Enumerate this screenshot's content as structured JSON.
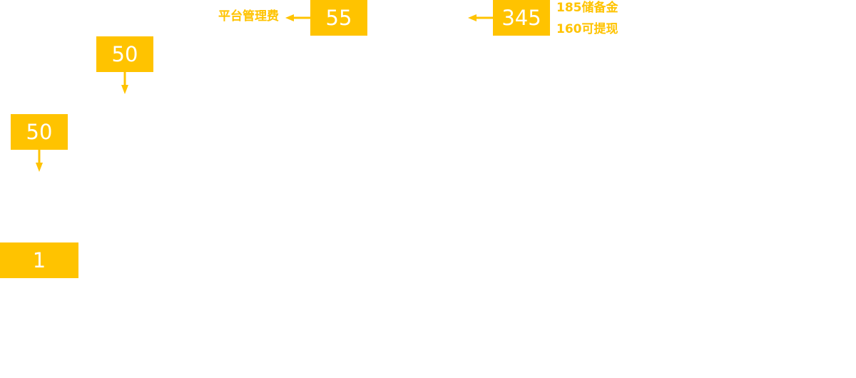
{
  "colors": {
    "accent": "#FFC300",
    "text_on_accent": "#FFFFFF",
    "background": "#FFFFFF"
  },
  "diagram": {
    "top_center_box": {
      "value": "55"
    },
    "top_right_box": {
      "value": "345"
    },
    "mid_left_box": {
      "value": "50"
    },
    "left_box": {
      "value": "50"
    },
    "bottom_left_box": {
      "value": "1"
    },
    "labels": {
      "platform_fee": "平台管理费",
      "reserve": "185储备金",
      "withdrawable": "160可提现"
    }
  }
}
